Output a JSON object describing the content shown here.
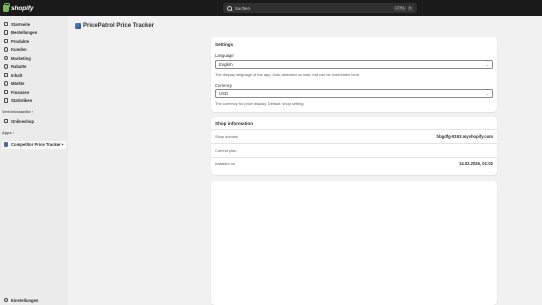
{
  "topbar": {
    "brand": "shopify",
    "search_placeholder": "Suchen",
    "shortcut_keys": [
      "CTRL",
      "K"
    ]
  },
  "sidebar": {
    "items": [
      {
        "label": "Startseite",
        "icon": "home-icon"
      },
      {
        "label": "Bestellungen",
        "icon": "inbox-icon"
      },
      {
        "label": "Produkte",
        "icon": "tag-icon"
      },
      {
        "label": "Kunden",
        "icon": "person-icon"
      },
      {
        "label": "Marketing",
        "icon": "target-icon"
      },
      {
        "label": "Rabatte",
        "icon": "discount-icon"
      },
      {
        "label": "Inhalt",
        "icon": "content-icon"
      },
      {
        "label": "Märkte",
        "icon": "globe-icon"
      },
      {
        "label": "Finanzen",
        "icon": "bank-icon"
      },
      {
        "label": "Statistiken",
        "icon": "chart-icon"
      }
    ],
    "sales_channels_heading": "Vertriebskanäle",
    "sales_channels": [
      {
        "label": "Onlineshop",
        "icon": "store-icon"
      }
    ],
    "apps_heading": "Apps",
    "apps": [
      {
        "label": "Competitor Price Tracker"
      }
    ],
    "settings_label": "Einstellungen"
  },
  "page": {
    "title": "PricePatrol Price Tracker"
  },
  "settings_card": {
    "title": "Settings",
    "language_label": "Language",
    "language_value": "English",
    "language_help": "The display language of the app. Auto-detected on load, but can be overridden here.",
    "currency_label": "Currency",
    "currency_value": "USD",
    "currency_help": "The currency for price display. Default: shop setting."
  },
  "shop_card": {
    "title": "Shop information",
    "rows": [
      {
        "key": "Shop domain",
        "value": "hbgdfg-8193.myshopify.com"
      },
      {
        "key": "Current plan",
        "value": ""
      },
      {
        "key": "Installed on",
        "value": "14.02.2026, 01:02"
      }
    ]
  }
}
